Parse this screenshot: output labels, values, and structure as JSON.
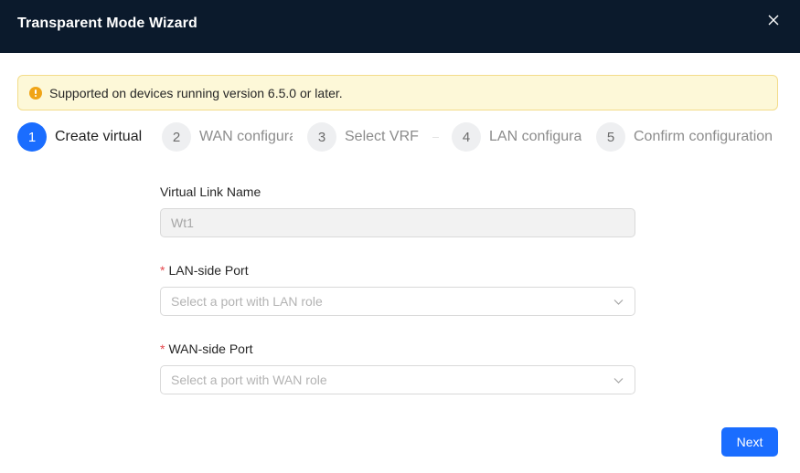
{
  "dialog": {
    "title": "Transparent Mode Wizard",
    "close_label": "X"
  },
  "alert": {
    "text": "Supported on devices running version 6.5.0 or later.",
    "icon": "warning-icon",
    "color": "#f0a417"
  },
  "steps": [
    {
      "number": "1",
      "label": "Create virtual",
      "active": true
    },
    {
      "number": "2",
      "label": "WAN configura",
      "active": false
    },
    {
      "number": "3",
      "label": "Select VRF",
      "active": false
    },
    {
      "number": "4",
      "label": "LAN configura",
      "active": false
    },
    {
      "number": "5",
      "label": "Confirm configuration",
      "active": false
    }
  ],
  "form": {
    "virtual_link_name": {
      "label": "Virtual Link Name",
      "value": "Wt1"
    },
    "lan_port": {
      "required_mark": "*",
      "label": "LAN-side Port",
      "placeholder": "Select a port with LAN role"
    },
    "wan_port": {
      "required_mark": "*",
      "label": "WAN-side Port",
      "placeholder": "Select a port with WAN role"
    }
  },
  "footer": {
    "next_label": "Next"
  },
  "colors": {
    "header_bg": "#0b1a2c",
    "primary": "#1a6dff",
    "alert_bg": "#fdf8d8",
    "required": "#e5484d"
  }
}
